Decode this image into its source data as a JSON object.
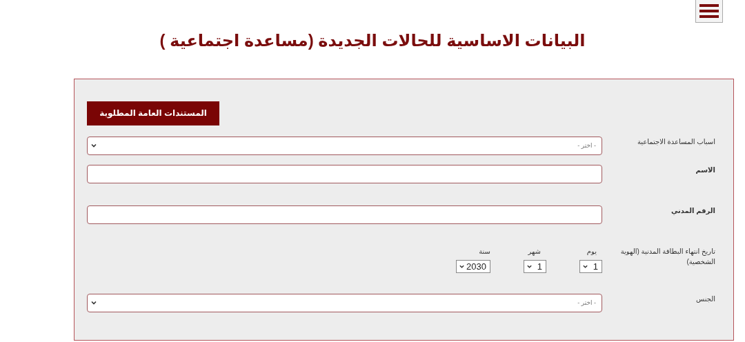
{
  "title": "البيانات الاساسية للحالات الجديدة (مساعدة اجتماعية )",
  "documents_button": "المستندات العامة المطلوبة",
  "fields": [
    {
      "kind": "select",
      "label": "اسباب المساعدة الاجتماعية",
      "placeholder": "- اختر -"
    },
    {
      "kind": "text",
      "label": "الاسم"
    },
    {
      "kind": "text",
      "label": "الرقم المدني"
    },
    {
      "kind": "date",
      "label": "تاريخ انتهاء البطاقة المدنية (الهوية الشخصية)",
      "parts": [
        {
          "label": "يوم",
          "value": "1"
        },
        {
          "label": "شهر",
          "value": "1"
        },
        {
          "label": "سنة",
          "value": "2030"
        }
      ]
    },
    {
      "kind": "select",
      "label": "الجنس",
      "placeholder": "- اختر -"
    }
  ]
}
